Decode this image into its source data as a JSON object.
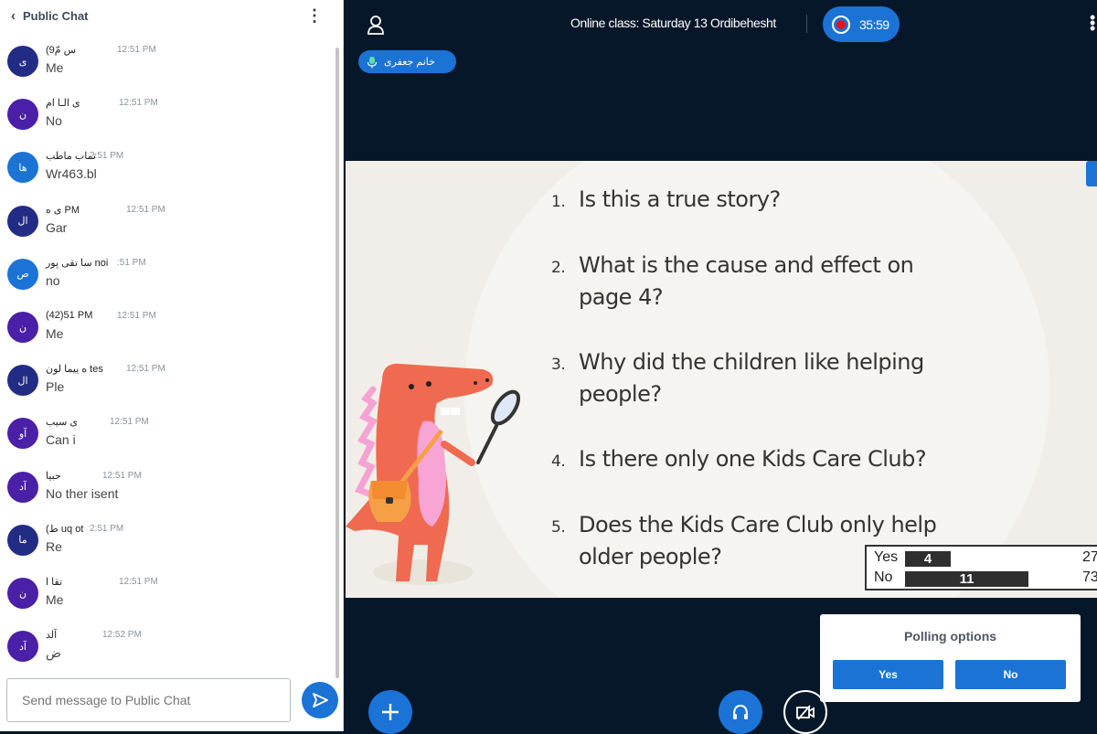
{
  "chat": {
    "title": "Public Chat",
    "input_placeholder": "Send message to Public Chat",
    "messages": [
      {
        "initials": "ی",
        "color": "#232c85",
        "name": "(9س مّ",
        "time": "12:51 PM",
        "text": "Me"
      },
      {
        "initials": "ن",
        "color": "#4a20a8",
        "name": "ی الـا ام",
        "time": "12:51 PM",
        "text": "No"
      },
      {
        "initials": "ها",
        "color": "#1b73d6",
        "name": "تماب ماطب",
        "time": "2:51 PM",
        "text": "Wr463.bl"
      },
      {
        "initials": "ال",
        "color": "#232c85",
        "name": "ی ه PM",
        "time": "12:51 PM",
        "text": "Gar"
      },
      {
        "initials": "ص",
        "color": "#1b73d6",
        "name": "سا تقی پور noi",
        "time": ":51 PM",
        "text": "no"
      },
      {
        "initials": "ن",
        "color": "#4a20a8",
        "name": "(42)51 PM",
        "time": "12:51 PM",
        "text": "Me"
      },
      {
        "initials": "ال",
        "color": "#232c85",
        "name": "ه ییما لون tes",
        "time": "12:51 PM",
        "text": "Ple"
      },
      {
        "initials": "آو",
        "color": "#4a20a8",
        "name": "ی سیب",
        "time": "12:51 PM",
        "text": "Can i"
      },
      {
        "initials": "آد",
        "color": "#4a20a8",
        "name": "حبیا",
        "time": "12:51 PM",
        "text": "No ther isent"
      },
      {
        "initials": "ما",
        "color": "#232c85",
        "name": "(ط uq ot",
        "time": "2:51 PM",
        "text": "Re"
      },
      {
        "initials": "ن",
        "color": "#4a20a8",
        "name": "تقا ا",
        "time": "12:51 PM",
        "text": "Me"
      },
      {
        "initials": "آد",
        "color": "#4a20a8",
        "name": "آلد",
        "time": "12:52 PM",
        "text": "ض"
      }
    ]
  },
  "topbar": {
    "session_title": "Online class: Saturday 13 Ordibehesht",
    "recording_time": "35:59",
    "talker_name": "خانم جعفری"
  },
  "slide": {
    "questions": [
      {
        "num": "1.",
        "text": "Is this a true story?"
      },
      {
        "num": "2.",
        "text": "What is the cause and effect on page 4?"
      },
      {
        "num": "3.",
        "text": "Why did the children like helping people?"
      },
      {
        "num": "4.",
        "text": "Is there only one Kids Care Club?"
      },
      {
        "num": "5.",
        "text": "Does the Kids Care Club only help older people?"
      }
    ]
  },
  "poll_result": {
    "rows": [
      {
        "label": "Yes",
        "count": "4",
        "percent": "27",
        "fraction": 0.27
      },
      {
        "label": "No",
        "count": "11",
        "percent": "73",
        "fraction": 0.73
      }
    ]
  },
  "polling_options": {
    "title": "Polling options",
    "yes_label": "Yes",
    "no_label": "No"
  },
  "colors": {
    "accent": "#1b73d6",
    "background": "#06172a",
    "record": "#e8121c"
  }
}
